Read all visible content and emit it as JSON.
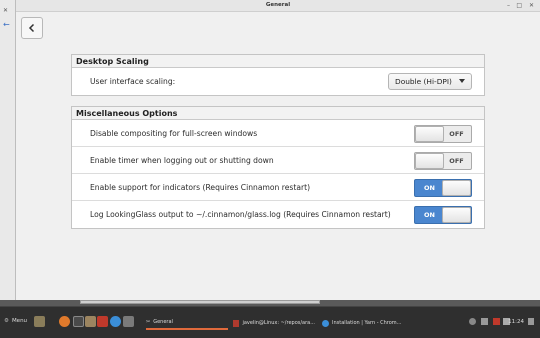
{
  "window": {
    "title": "General"
  },
  "sections": [
    {
      "header": "Desktop Scaling",
      "rows": [
        {
          "label": "User interface scaling:",
          "control": "dropdown",
          "value": "Double (Hi-DPI)"
        }
      ]
    },
    {
      "header": "Miscellaneous Options",
      "rows": [
        {
          "label": "Disable compositing for full-screen windows",
          "control": "switch",
          "state": "OFF"
        },
        {
          "label": "Enable timer when logging out or shutting down",
          "control": "switch",
          "state": "OFF"
        },
        {
          "label": "Enable support for indicators (Requires Cinnamon restart)",
          "control": "switch",
          "state": "ON"
        },
        {
          "label": "Log LookingGlass output to ~/.cinnamon/glass.log (Requires Cinnamon restart)",
          "control": "switch",
          "state": "ON"
        }
      ]
    }
  ],
  "taskbar": {
    "menu_label": "Menu",
    "tasks": [
      {
        "label": "General",
        "active": true
      },
      {
        "label": "javelin@Linux: ~/repos/ara...",
        "active": false
      },
      {
        "label": "Installation | Yarn - Chrom...",
        "active": false
      }
    ],
    "clock": "11:24"
  },
  "colors": {
    "switch_on": "#4a86cf",
    "panel": "#2f2f2f",
    "active_task": "#e06a3c"
  }
}
